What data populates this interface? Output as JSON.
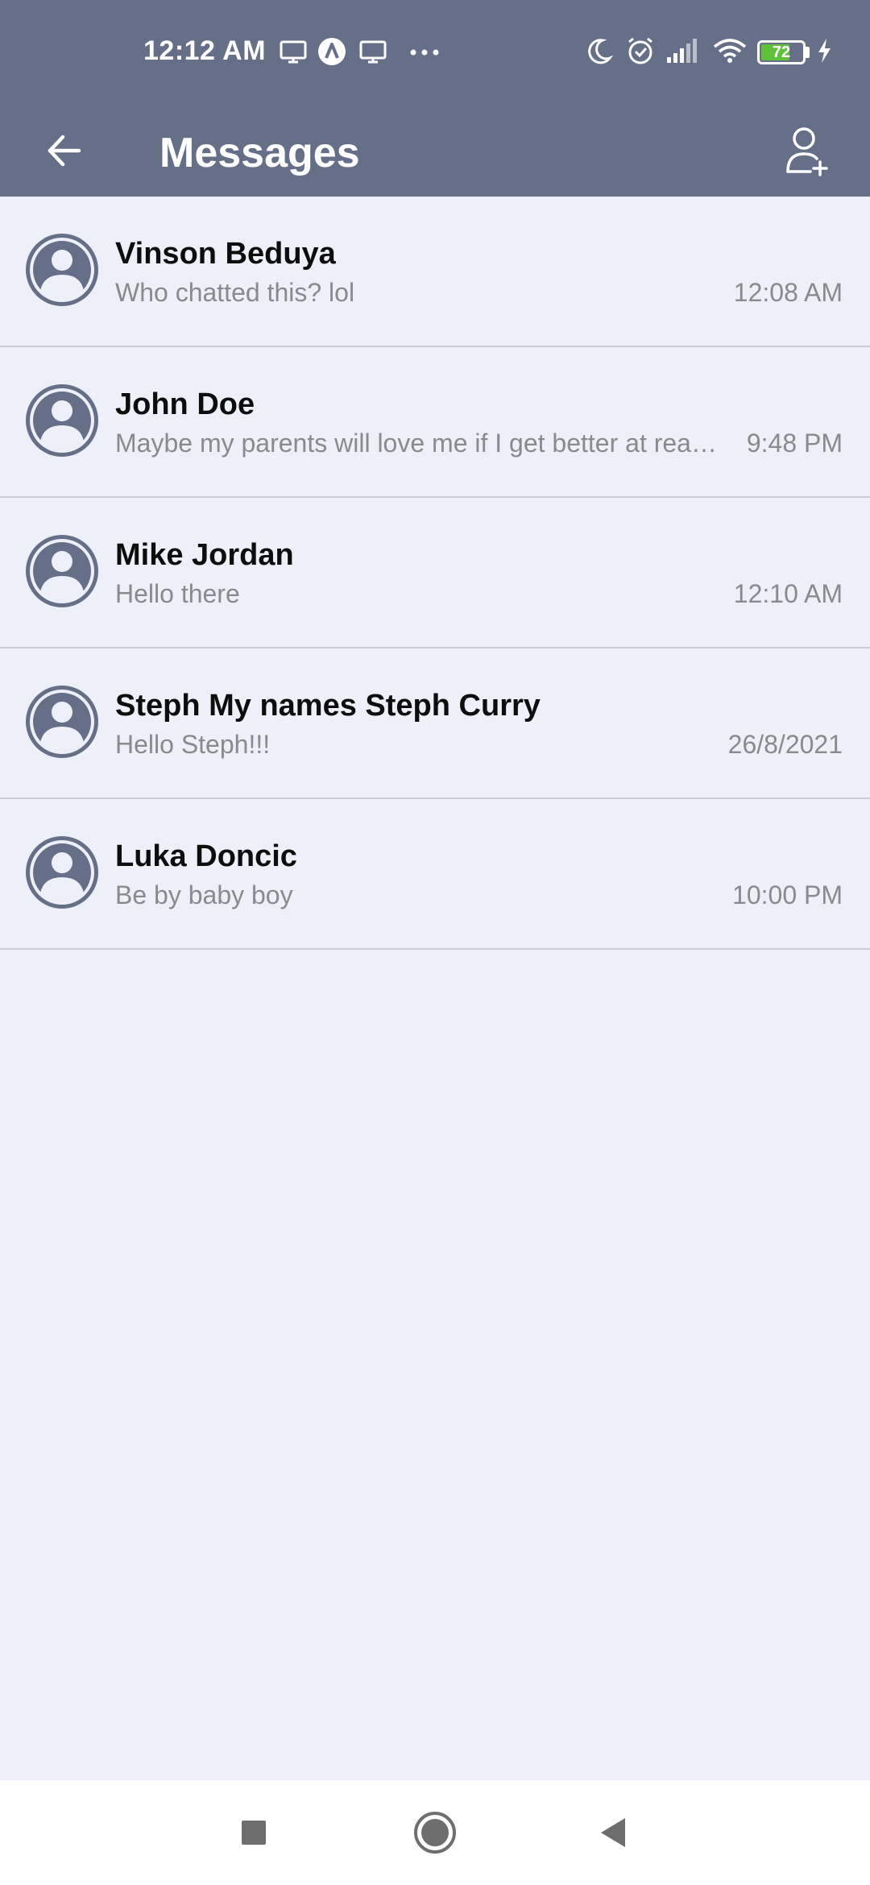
{
  "status_bar": {
    "time": "12:12 AM",
    "battery_level": "72",
    "battery_fraction": 0.72,
    "icons": [
      "monitor-icon",
      "a-circle-icon",
      "monitor-icon",
      "more-dots-icon",
      "moon-icon",
      "alarm-icon",
      "signal-icon",
      "wifi-icon",
      "battery-icon",
      "charging-icon"
    ]
  },
  "app_bar": {
    "title": "Messages",
    "back_icon": "arrow-left-icon",
    "add_icon": "add-person-icon"
  },
  "colors": {
    "header": "#656f87",
    "background": "#edf0f8",
    "avatar": "#656f87",
    "divider": "#cacdd6",
    "secondary_text": "#8a8a8e",
    "battery_fill": "#5fc13a"
  },
  "messages": [
    {
      "name": "Vinson Beduya",
      "preview": "Who chatted this? lol",
      "time": "12:08 AM"
    },
    {
      "name": "John Doe",
      "preview": "Maybe my parents will love me if I get better at reading",
      "time": "9:48 PM"
    },
    {
      "name": "Mike Jordan",
      "preview": "Hello there",
      "time": "12:10 AM"
    },
    {
      "name": "Steph My names Steph Curry",
      "preview": "Hello Steph!!!",
      "time": "26/8/2021"
    },
    {
      "name": "Luka Doncic",
      "preview": "Be by baby boy",
      "time": "10:00 PM"
    }
  ],
  "nav_bar": {
    "buttons": [
      "recents-square-icon",
      "home-circle-icon",
      "back-triangle-icon"
    ]
  }
}
